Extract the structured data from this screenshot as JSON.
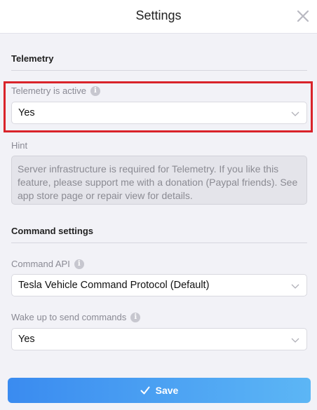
{
  "header": {
    "title": "Settings",
    "close_icon": "close-icon"
  },
  "telemetry": {
    "section_title": "Telemetry",
    "active_label": "Telemetry is active",
    "active_value": "Yes",
    "hint_label": "Hint",
    "hint_text": "Server infrastructure is required for Telemetry. If you like this feature, please support me with a donation (Paypal friends). See app store page or repair view for details."
  },
  "command_settings": {
    "section_title": "Command settings",
    "api_label": "Command API",
    "api_value": "Tesla Vehicle Command Protocol (Default)",
    "wake_label": "Wake up to send commands",
    "wake_value": "Yes"
  },
  "footer": {
    "save_label": "Save",
    "save_icon": "checkmark-icon"
  },
  "colors": {
    "highlight": "#d9232a",
    "save_gradient_start": "#3a8bf0",
    "save_gradient_end": "#5cb6f5"
  }
}
